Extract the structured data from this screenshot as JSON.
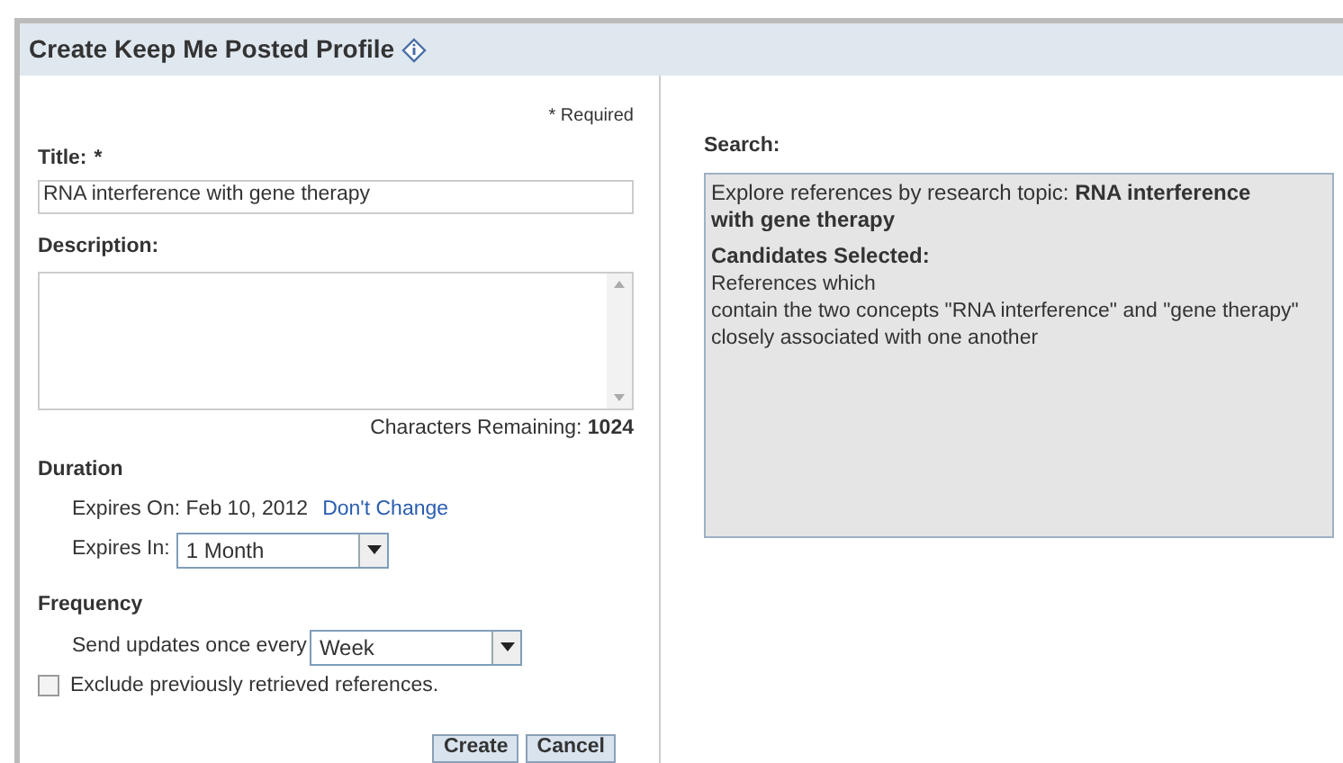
{
  "dialog": {
    "title": "Create Keep Me Posted Profile"
  },
  "form": {
    "required_note": "* Required",
    "title_field": {
      "label": "Title:",
      "required_mark": "*",
      "value": "RNA interference with gene therapy"
    },
    "description_field": {
      "label": "Description:"
    },
    "characters_remaining": {
      "label": "Characters Remaining:",
      "value": "1024"
    },
    "duration": {
      "heading": "Duration",
      "expires_on_label": "Expires On:",
      "expires_on_value": "Feb 10, 2012",
      "dont_change_link": "Don't Change",
      "expires_in_label": "Expires In:",
      "expires_in_value": "1 Month"
    },
    "frequency": {
      "heading": "Frequency",
      "send_label": "Send updates once every",
      "send_value": "Week"
    },
    "exclude_checkbox": {
      "label": "Exclude previously retrieved references.",
      "checked": false
    },
    "buttons": [
      "Create",
      "Cancel"
    ]
  },
  "search": {
    "label": "Search:",
    "topic": "Explore references by research topic:  **RNA interference with gene therapy**",
    "candidates_heading": "Candidates Selected:",
    "lines": [
      "References which",
      "contain the two concepts \"RNA interference\" and \"gene therapy\" closely associated with one another"
    ]
  }
}
